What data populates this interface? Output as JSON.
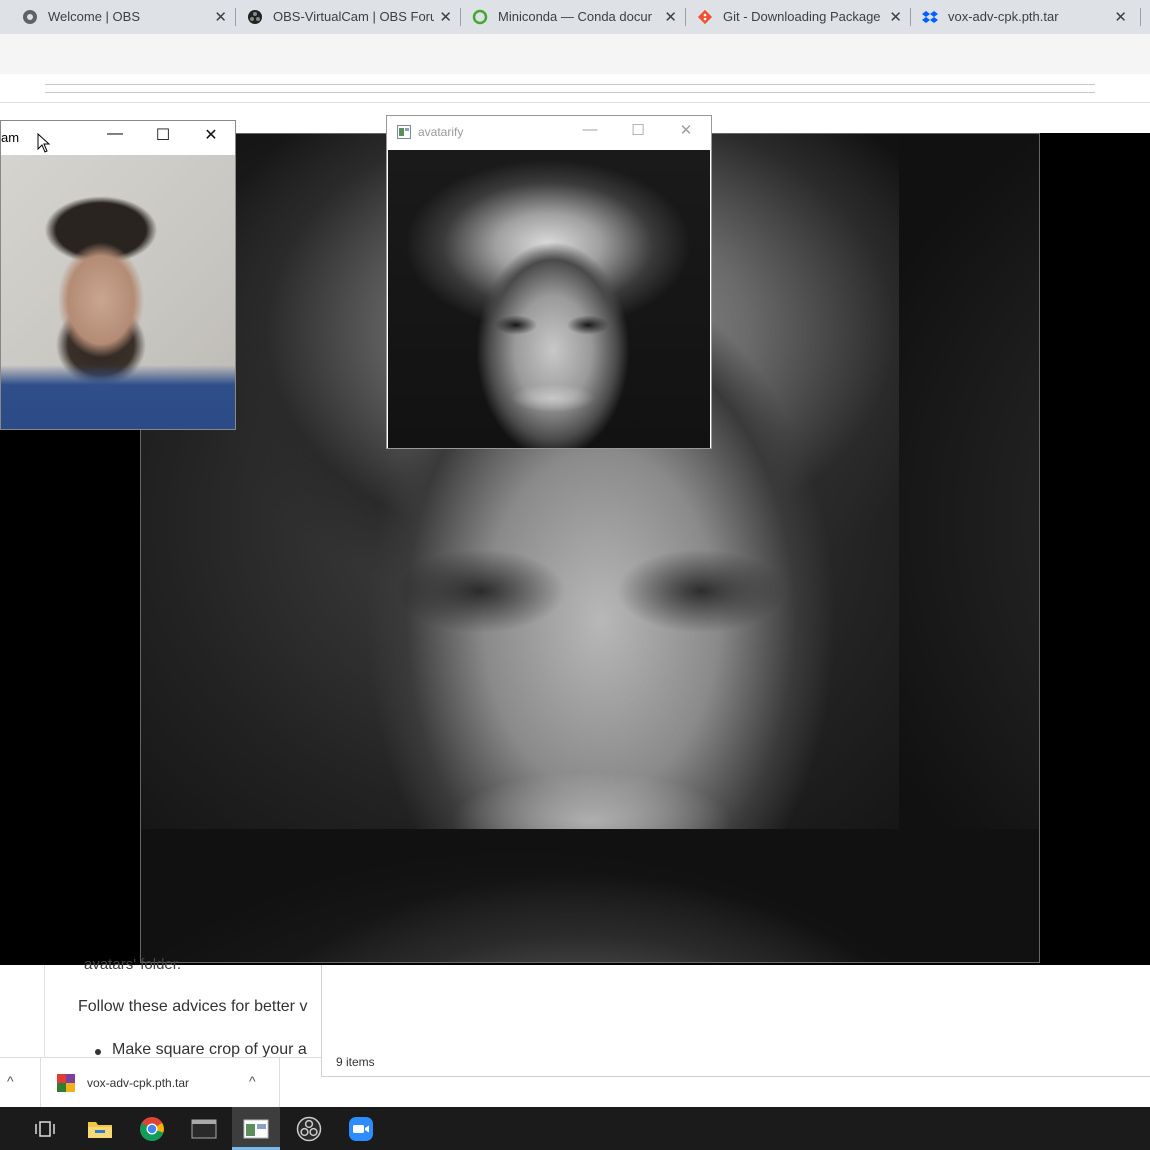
{
  "browser": {
    "tabs": [
      {
        "title": "Welcome | OBS",
        "icon": "obs-globe-icon"
      },
      {
        "title": "OBS-VirtualCam | OBS Foru",
        "icon": "obs-logo-icon"
      },
      {
        "title": "Miniconda — Conda docur",
        "icon": "conda-ring-icon"
      },
      {
        "title": "Git - Downloading Package",
        "icon": "git-logo-icon"
      },
      {
        "title": "vox-adv-cpk.pth.tar",
        "icon": "dropbox-icon"
      }
    ],
    "close_glyph": "✕"
  },
  "webcam_window": {
    "title": "am",
    "minimize": "—",
    "maximize": "☐",
    "close": "✕"
  },
  "avatarify_window": {
    "title": "avatarify",
    "minimize": "—",
    "maximize": "☐",
    "close": "✕"
  },
  "page": {
    "folder_fragment": "avatars' folder.",
    "advice_text": "Follow these advices for better v",
    "bullet_text": "Make square crop of your a"
  },
  "explorer": {
    "status": "9 items"
  },
  "download_bar": {
    "file_name": "vox-adv-cpk.pth.tar",
    "chevron": "^"
  },
  "taskbar": {
    "items": [
      "task-view-icon",
      "file-explorer-icon",
      "chrome-icon",
      "terminal-icon",
      "avatarify-app-icon",
      "obs-icon",
      "zoom-icon"
    ]
  },
  "colors": {
    "tabstrip": "#dee1e6",
    "taskbar": "#1b1b1b",
    "zoom_blue": "#2d8cff",
    "active_indicator": "#76b9ed"
  }
}
